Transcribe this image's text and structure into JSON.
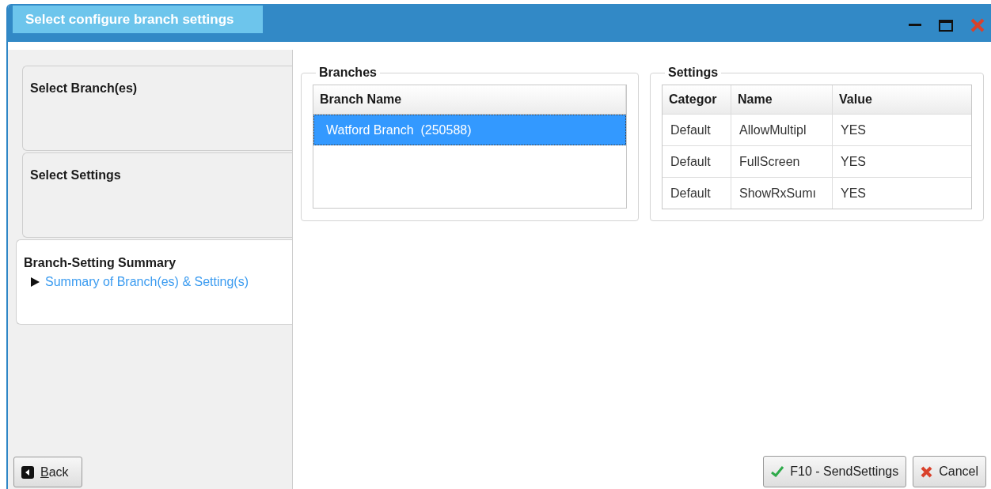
{
  "window": {
    "title": "Select configure branch settings"
  },
  "steps": [
    {
      "title": "Select Branch(es)",
      "selected": false
    },
    {
      "title": "Select Settings",
      "selected": false
    },
    {
      "title": "Branch-Setting Summary",
      "selected": true,
      "children": [
        {
          "label": "Summary of Branch(es) & Setting(s)"
        }
      ]
    }
  ],
  "back_button": {
    "label": "Back"
  },
  "branches": {
    "title": "Branches",
    "columns": [
      "Branch Name"
    ],
    "rows": [
      {
        "cells": [
          "Watford Branch  (250588)"
        ],
        "selected": true
      }
    ]
  },
  "settings": {
    "title": "Settings",
    "columns": [
      "Categor",
      "Name",
      "Value"
    ],
    "rows": [
      {
        "cells": [
          "Default",
          "AllowMultipl",
          "YES"
        ]
      },
      {
        "cells": [
          "Default",
          "FullScreen",
          "YES"
        ]
      },
      {
        "cells": [
          "Default",
          "ShowRxSumı",
          "YES"
        ]
      }
    ]
  },
  "buttons": [
    {
      "kind": "send",
      "label": "F10 - SendSettings"
    },
    {
      "kind": "cancel",
      "label": "Cancel"
    }
  ]
}
